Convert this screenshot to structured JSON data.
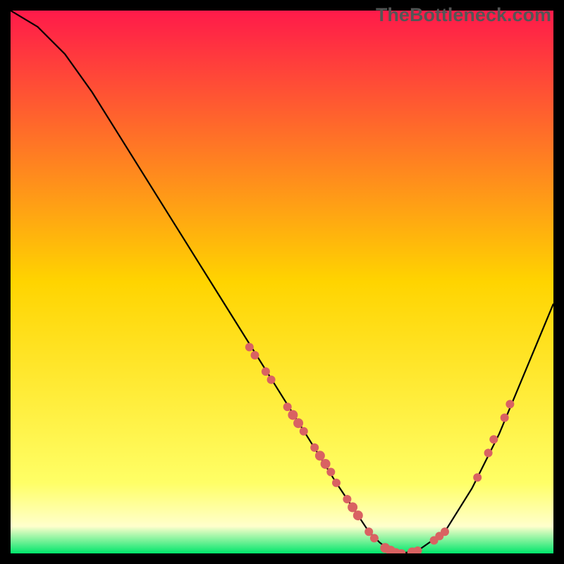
{
  "watermark": "TheBottleneck.com",
  "chart_data": {
    "type": "line",
    "title": "",
    "xlabel": "",
    "ylabel": "",
    "xlim": [
      0,
      100
    ],
    "ylim": [
      0,
      100
    ],
    "gradient_stops": [
      {
        "offset": 0,
        "color": "#ff1a4a"
      },
      {
        "offset": 50,
        "color": "#ffd400"
      },
      {
        "offset": 87,
        "color": "#ffff66"
      },
      {
        "offset": 95,
        "color": "#ffffcc"
      },
      {
        "offset": 100,
        "color": "#00e66b"
      }
    ],
    "series": [
      {
        "name": "curve",
        "x": [
          0,
          5,
          10,
          15,
          20,
          25,
          30,
          35,
          40,
          45,
          50,
          55,
          60,
          62,
          64,
          66,
          68,
          70,
          72,
          75,
          80,
          85,
          90,
          95,
          100
        ],
        "y": [
          100,
          97,
          92,
          85,
          77,
          69,
          61,
          53,
          45,
          37,
          29,
          21,
          13,
          10,
          7,
          4,
          2,
          0.5,
          0,
          0.5,
          4,
          12,
          22,
          34,
          46
        ],
        "stroke": "#000000"
      }
    ],
    "points": [
      {
        "x": 44,
        "y": 38,
        "r": 6
      },
      {
        "x": 45,
        "y": 36.5,
        "r": 6
      },
      {
        "x": 47,
        "y": 33.5,
        "r": 6
      },
      {
        "x": 48,
        "y": 32,
        "r": 6
      },
      {
        "x": 51,
        "y": 27,
        "r": 6
      },
      {
        "x": 52,
        "y": 25.5,
        "r": 7
      },
      {
        "x": 53,
        "y": 24,
        "r": 7
      },
      {
        "x": 54,
        "y": 22.5,
        "r": 6
      },
      {
        "x": 56,
        "y": 19.5,
        "r": 6
      },
      {
        "x": 57,
        "y": 18,
        "r": 7
      },
      {
        "x": 58,
        "y": 16.5,
        "r": 7
      },
      {
        "x": 59,
        "y": 15,
        "r": 6
      },
      {
        "x": 60,
        "y": 13,
        "r": 6
      },
      {
        "x": 62,
        "y": 10,
        "r": 6
      },
      {
        "x": 63,
        "y": 8.5,
        "r": 7
      },
      {
        "x": 64,
        "y": 7,
        "r": 7
      },
      {
        "x": 66,
        "y": 4,
        "r": 6
      },
      {
        "x": 67,
        "y": 2.8,
        "r": 6
      },
      {
        "x": 69,
        "y": 1,
        "r": 7
      },
      {
        "x": 70,
        "y": 0.5,
        "r": 7
      },
      {
        "x": 71,
        "y": 0.2,
        "r": 6
      },
      {
        "x": 72,
        "y": 0,
        "r": 6
      },
      {
        "x": 74,
        "y": 0.2,
        "r": 7
      },
      {
        "x": 75,
        "y": 0.5,
        "r": 6
      },
      {
        "x": 78,
        "y": 2.4,
        "r": 6
      },
      {
        "x": 79,
        "y": 3.2,
        "r": 6
      },
      {
        "x": 80,
        "y": 4,
        "r": 6
      },
      {
        "x": 86,
        "y": 14,
        "r": 6
      },
      {
        "x": 88,
        "y": 18.5,
        "r": 6
      },
      {
        "x": 89,
        "y": 21,
        "r": 6
      },
      {
        "x": 91,
        "y": 25,
        "r": 6
      },
      {
        "x": 92,
        "y": 27.5,
        "r": 6
      }
    ],
    "point_color": "#d96262"
  }
}
